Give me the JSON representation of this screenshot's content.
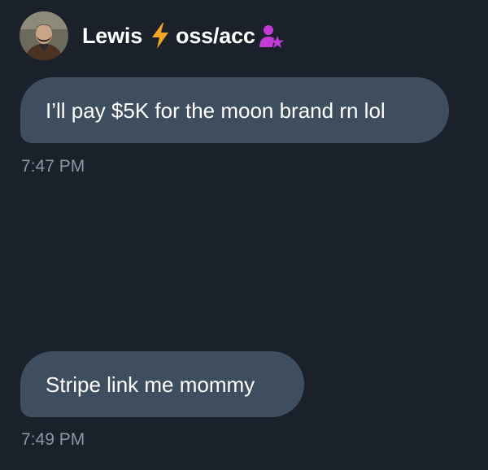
{
  "header": {
    "avatar_alt": "Lewis avatar",
    "name": "Lewis",
    "handle_suffix": "oss/acc",
    "icons": [
      "avatar",
      "lightning-bolt-icon",
      "person-star-icon"
    ]
  },
  "messages": [
    {
      "text": "I’ll pay $5K for the moon brand rn lol",
      "time": "7:47 PM"
    },
    {
      "text": "Stripe link me mommy",
      "time": "7:49 PM"
    }
  ],
  "colors": {
    "background": "#1a212b",
    "bubble": "#3e4e5e",
    "timestamp": "#8a96a3",
    "bolt": "#f4a623",
    "person_star": "#c23bd4"
  }
}
